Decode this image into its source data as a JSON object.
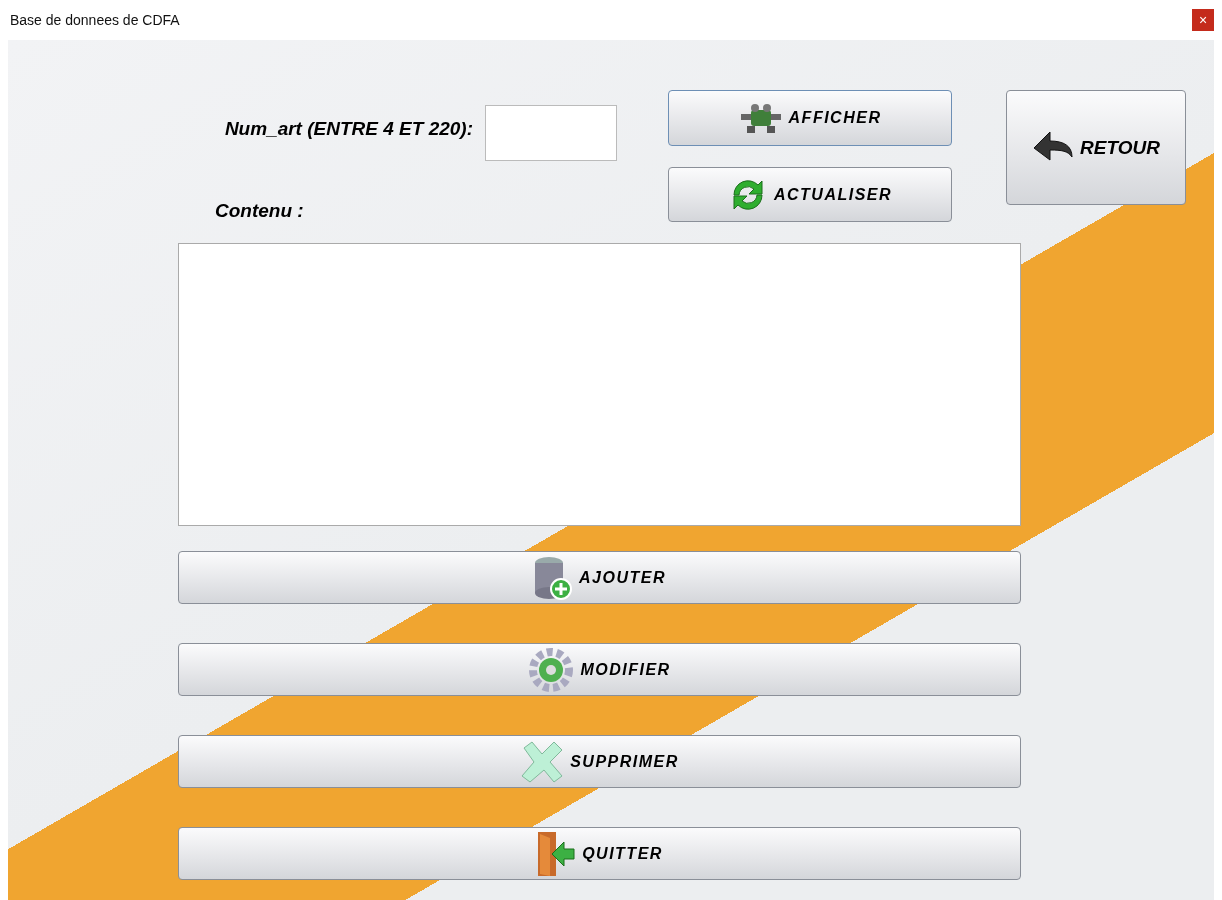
{
  "window": {
    "title": "Base de donnees de CDFA",
    "close_glyph": "×"
  },
  "num_art": {
    "label": "Num_art (ENTRE 4 ET 220):"
  },
  "contenu": {
    "label": "Contenu :"
  },
  "top_buttons": [
    {
      "label": "AFFICHER"
    },
    {
      "label": "ACTUALISER"
    },
    {
      "label": "RETOUR"
    }
  ],
  "actions": [
    {
      "label": "AJOUTER"
    },
    {
      "label": "MODIFIER"
    },
    {
      "label": "SUPPRIMER"
    },
    {
      "label": "QUITTER"
    }
  ]
}
